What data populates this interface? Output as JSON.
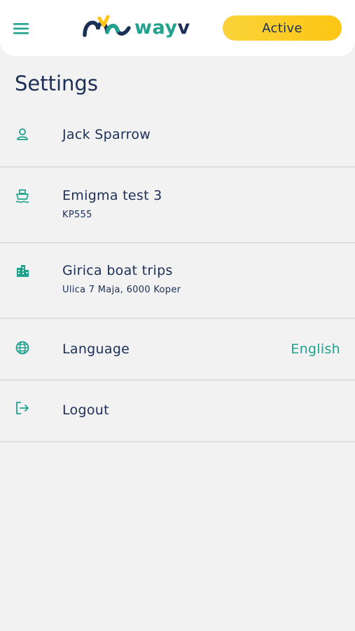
{
  "header": {
    "menu_icon": "hamburger-menu-icon",
    "logo_text_way": "way",
    "logo_text_v": "v",
    "status_label": "Active"
  },
  "colors": {
    "brand_teal": "#20a28e",
    "brand_navy": "#1b2f57",
    "status_yellow": "#fcc613",
    "background": "#f2f2f2"
  },
  "page": {
    "title": "Settings"
  },
  "settings": {
    "user": {
      "icon": "person-icon",
      "name": "Jack Sparrow"
    },
    "vessel": {
      "icon": "boat-icon",
      "name": "Emigma test 3",
      "code": "KP555"
    },
    "company": {
      "icon": "building-icon",
      "name": "Girica boat trips",
      "address": "Ulica 7 Maja, 6000 Koper"
    },
    "language": {
      "icon": "globe-icon",
      "label": "Language",
      "value": "English"
    },
    "logout": {
      "icon": "logout-icon",
      "label": "Logout"
    }
  }
}
